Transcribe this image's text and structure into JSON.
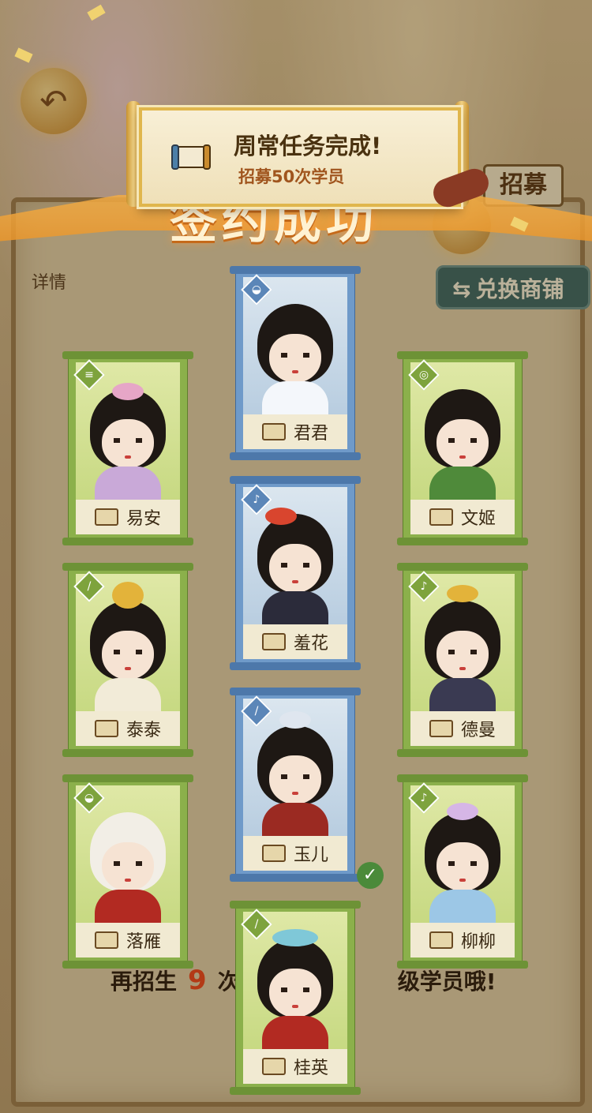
{
  "toast": {
    "title": "周常任务完成!",
    "subtitle": "招募50次学员"
  },
  "banner": "签约成功",
  "side": {
    "recruit": "招募",
    "exchange": "兑换商铺",
    "details": "详情"
  },
  "footer": {
    "prefix": "再招生",
    "count": "9",
    "mid": "次",
    "suffix": "级学员哦!"
  },
  "cards": [
    {
      "name": "君君",
      "frame": "blue"
    },
    {
      "name": "易安",
      "frame": "green"
    },
    {
      "name": "文姬",
      "frame": "green"
    },
    {
      "name": "羞花",
      "frame": "blue"
    },
    {
      "name": "泰泰",
      "frame": "green"
    },
    {
      "name": "德曼",
      "frame": "green"
    },
    {
      "name": "玉儿",
      "frame": "blue"
    },
    {
      "name": "落雁",
      "frame": "green"
    },
    {
      "name": "柳柳",
      "frame": "green"
    },
    {
      "name": "桂英",
      "frame": "green"
    }
  ],
  "colors": {
    "green_frame": "#8bb04b",
    "blue_frame": "#6f9ac9",
    "gold": "#e0b64d"
  }
}
